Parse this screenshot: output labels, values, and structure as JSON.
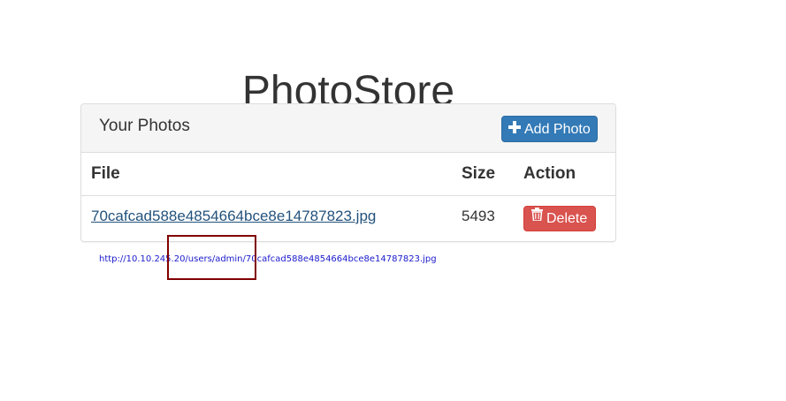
{
  "page": {
    "title": "PhotoStore"
  },
  "panel": {
    "title": "Your Photos",
    "add_button_label": "Add Photo",
    "add_icon": "plus-icon"
  },
  "table": {
    "columns": [
      "File",
      "Size",
      "Action"
    ],
    "rows": [
      {
        "file": "70cafcad588e4854664bce8e14787823.jpg",
        "size": "5493",
        "action_label": "Delete",
        "action_icon": "trash-icon"
      }
    ]
  },
  "status_bar": {
    "hover_url": "http://10.10.245.20/users/admin/70cafcad588e4854664bce8e14787823.jpg"
  },
  "colors": {
    "primary": "#337ab7",
    "danger": "#d9534f",
    "link": "#23527c",
    "highlight": "#800000"
  }
}
